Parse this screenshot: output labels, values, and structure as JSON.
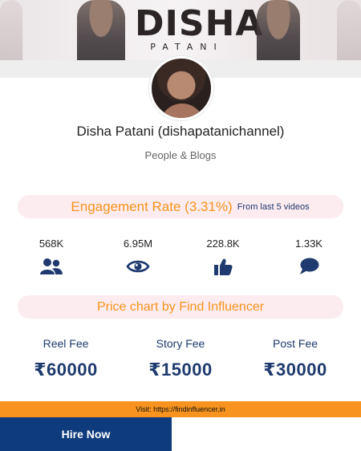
{
  "banner": {
    "brand_name": "DISHA",
    "brand_sub": "PATANI"
  },
  "profile": {
    "name": "Disha Patani (dishapatanichannel)",
    "category": "People & Blogs"
  },
  "engagement": {
    "title": "Engagement Rate (3.31%)",
    "note": "From last 5 videos"
  },
  "stats": [
    {
      "value": "568K",
      "icon": "users-icon"
    },
    {
      "value": "6.95M",
      "icon": "eye-icon"
    },
    {
      "value": "228.8K",
      "icon": "thumbs-up-icon"
    },
    {
      "value": "1.33K",
      "icon": "comment-icon"
    }
  ],
  "price_chart": {
    "title": "Price chart by Find Influencer"
  },
  "fees": [
    {
      "label": "Reel Fee",
      "amount": "₹60000"
    },
    {
      "label": "Story Fee",
      "amount": "₹15000"
    },
    {
      "label": "Post Fee",
      "amount": "₹30000"
    }
  ],
  "footer": {
    "visit_text": "Visit: https://findinfluencer.in",
    "hire_label": "Hire Now"
  },
  "colors": {
    "accent_orange": "#f7931e",
    "navy": "#1e3a6e",
    "button_blue": "#0d3b7c",
    "pill_pink": "#fdecef"
  }
}
